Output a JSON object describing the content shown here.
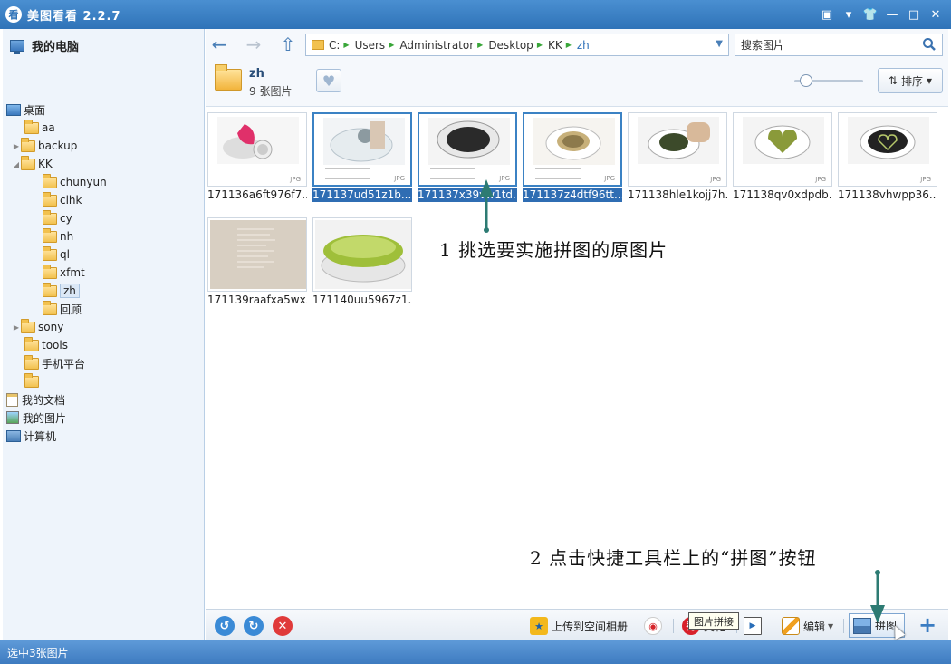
{
  "app": {
    "title": "美图看看 2.2.7",
    "logo_text": "看",
    "window_buttons": [
      "▣",
      "▾",
      "👕",
      "—",
      "□",
      "✕"
    ]
  },
  "sidebar": {
    "title": "我的电脑",
    "items": [
      {
        "label": "桌面",
        "icon": "desktop-icon"
      },
      {
        "label": "aa"
      },
      {
        "label": "backup",
        "arrow": "▶"
      },
      {
        "label": "KK",
        "arrow": "◢"
      },
      {
        "label": "chunyun"
      },
      {
        "label": "clhk"
      },
      {
        "label": "cy"
      },
      {
        "label": "nh"
      },
      {
        "label": "ql"
      },
      {
        "label": "xfmt"
      },
      {
        "label": "zh"
      },
      {
        "label": "回顾"
      },
      {
        "label": "sony",
        "arrow": "▶"
      },
      {
        "label": "tools"
      },
      {
        "label": "手机平台"
      },
      {
        "label": ""
      },
      {
        "label": "我的文档",
        "icon": "documents-icon"
      },
      {
        "label": "我的图片",
        "icon": "pictures-icon"
      },
      {
        "label": "计算机",
        "icon": "computer-icon"
      }
    ]
  },
  "nav": {
    "back": "←",
    "forward": "→",
    "up": "⇧",
    "path": [
      "C:",
      "Users",
      "Administrator",
      "Desktop",
      "KK",
      "zh"
    ],
    "search_placeholder": "搜索图片"
  },
  "folder": {
    "name": "zh",
    "count": "9 张图片",
    "fav_icon": "♥",
    "sort_label": "排序",
    "sort_icon": "⇅",
    "zoom_level": 0.1
  },
  "thumbnails": [
    {
      "name": "171136a6ft976f7...",
      "selected": false
    },
    {
      "name": "171137ud51z1b...",
      "selected": true
    },
    {
      "name": "171137x39vw1td...",
      "selected": true
    },
    {
      "name": "171137z4dtf96tt...",
      "selected": true
    },
    {
      "name": "171138hle1kojj7h...",
      "selected": false
    },
    {
      "name": "171138qv0xdpdb...",
      "selected": false
    },
    {
      "name": "171138vhwpp36...",
      "selected": false
    },
    {
      "name": "171139raafxa5wx...",
      "selected": false
    },
    {
      "name": "171140uu5967z1...",
      "selected": false
    }
  ],
  "thumb_ext": "JPG",
  "annotations": {
    "step1": "1  挑选要实施拼图的原图片",
    "step2": "2  点击快捷工具栏上的“拼图”按钮"
  },
  "toolbar": {
    "rotate_left": "↺",
    "rotate_right": "↻",
    "delete": "✕",
    "upload": "上传到空间相册",
    "beautify": "美化",
    "beautify_icon": "秀",
    "edit": "编辑",
    "collage": "拼图",
    "add": "+"
  },
  "tooltip": "图片拼接",
  "status": "选中3张图片",
  "colors": {
    "accent": "#2f73b8",
    "selection": "#2f6db3",
    "annotation_arrow": "#2d7b73"
  }
}
